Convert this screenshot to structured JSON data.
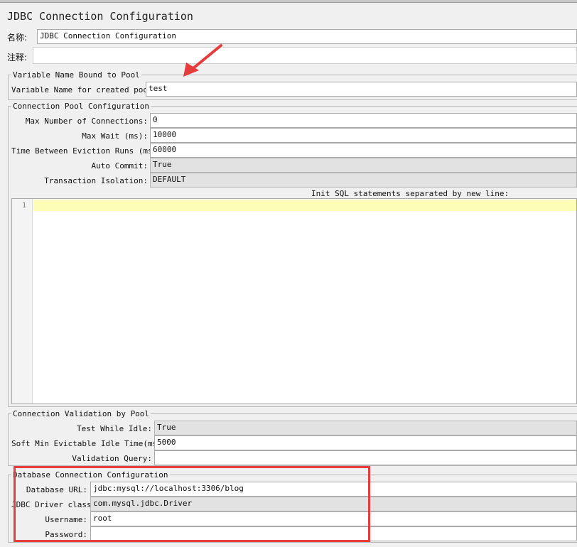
{
  "window": {
    "title": "JDBC Connection Configuration"
  },
  "header": {
    "name_label": "名称:",
    "name_value": "JDBC Connection Configuration",
    "comment_label": "注释:",
    "comment_value": ""
  },
  "variable_pool": {
    "legend": "Variable Name Bound to Pool",
    "var_label": "Variable Name for created pool:",
    "var_value": "test"
  },
  "pool_config": {
    "legend": "Connection Pool Configuration",
    "max_conn_label": "Max Number of Connections:",
    "max_conn_value": "0",
    "max_wait_label": "Max Wait (ms):",
    "max_wait_value": "10000",
    "eviction_label": "Time Between Eviction Runs (ms):",
    "eviction_value": "60000",
    "auto_commit_label": "Auto Commit:",
    "auto_commit_value": "True",
    "isolation_label": "Transaction Isolation:",
    "isolation_value": "DEFAULT",
    "init_sql_label": "Init SQL statements separated by new line:",
    "line_number": "1"
  },
  "validation": {
    "legend": "Connection Validation by Pool",
    "test_idle_label": "Test While Idle:",
    "test_idle_value": "True",
    "soft_min_label": "Soft Min Evictable Idle Time(ms):",
    "soft_min_value": "5000",
    "query_label": "Validation Query:",
    "query_value": ""
  },
  "database": {
    "legend": "Database Connection Configuration",
    "url_label": "Database URL:",
    "url_value": "jdbc:mysql://localhost:3306/blog",
    "driver_label": "JDBC Driver class:",
    "driver_value": "com.mysql.jdbc.Driver",
    "username_label": "Username:",
    "username_value": "root",
    "password_label": "Password:",
    "password_value": ""
  },
  "colors": {
    "annotation_red": "#e63c3c",
    "current_line_highlight": "#fdfdb8",
    "panel_bg": "#f0f0f0"
  }
}
